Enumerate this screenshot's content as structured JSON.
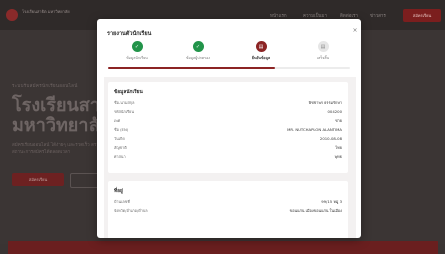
{
  "background": {
    "school_short": "โรงเรียนสาธิต มหาวิทยาลัย",
    "nav": [
      "หน้าแรก",
      "ความเป็นมา",
      "ติดต่อเรา",
      "ข่าวสาร"
    ],
    "header_button": "สมัครเรียน",
    "kicker": "ระบบรับสมัครนักเรียนออนไลน์",
    "headline_1": "โรงเรียนสาธิต",
    "headline_2": "มหาวิทยาลัย",
    "description": "สมัครเรียนออนไลน์ ได้ง่ายๆ และรวดเร็ว ตรวจสอบสถานะการสมัครได้ตลอดเวลา",
    "cta_primary": "สมัครเรียน",
    "accent_color": "#7b1e1e"
  },
  "modal": {
    "title": "รายงานตัวนักเรียน",
    "close": "×",
    "steps": [
      {
        "label": "ข้อมูลนักเรียน",
        "status": "done",
        "icon": "check-icon"
      },
      {
        "label": "ข้อมูลผู้ปกครอง",
        "status": "done",
        "icon": "check-icon"
      },
      {
        "label": "ยืนยันข้อมูล",
        "status": "active",
        "icon": "document-icon"
      },
      {
        "label": "เสร็จสิ้น",
        "status": "pending",
        "icon": "document-icon"
      }
    ],
    "progress_fraction": 0.69,
    "student_section": {
      "heading": "ข้อมูลนักเรียน",
      "rows": [
        {
          "label": "ชื่อ-นามสกุล",
          "value": "พิชชาพร ธรรมรักษา"
        },
        {
          "label": "รหัสนักเรียน",
          "value": "004200"
        },
        {
          "label": "เพศ",
          "value": "ชาย"
        },
        {
          "label": "ชื่อ (EN)",
          "value": "MR. NUTCHAPLON ALANTIMA"
        },
        {
          "label": "วันเกิด",
          "value": "2010-08-08"
        },
        {
          "label": "สัญชาติ",
          "value": "ไทย"
        },
        {
          "label": "ศาสนา",
          "value": "พุทธ"
        }
      ]
    },
    "address_section": {
      "heading": "ที่อยู่",
      "rows": [
        {
          "label": "บ้านเลขที่",
          "value": "99/15 หมู่ 3"
        },
        {
          "label": "จังหวัด/อำเภอ/ตำบล",
          "value": "ขอนแก่น เมืองขอนแก่น ในเมือง"
        }
      ]
    },
    "colors": {
      "done": "#22944a",
      "active": "#8c2424",
      "pending": "#e6e6e6"
    }
  }
}
